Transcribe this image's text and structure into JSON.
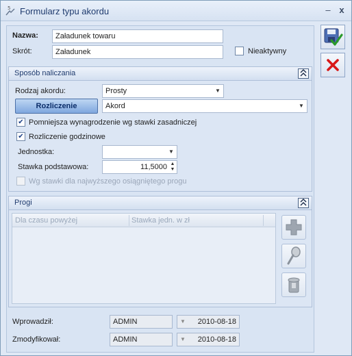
{
  "window": {
    "title": "Formularz typu akordu",
    "minimize_label": "–",
    "close_label": "x"
  },
  "header": {
    "name_label": "Nazwa:",
    "name_value": "Załadunek towaru",
    "short_label": "Skrót:",
    "short_value": "Załadunek",
    "inactive_label": "Nieaktywny",
    "inactive_checked": false
  },
  "calc_panel": {
    "title": "Sposób naliczania",
    "collapse_glyph": "⌃⌃",
    "type_label": "Rodzaj akordu:",
    "type_value": "Prosty",
    "settlement_button": "Rozliczenie",
    "settlement_value": "Akord",
    "reduce_label": "Pomniejsza wynagrodzenie wg stawki zasadniczej",
    "reduce_checked": true,
    "hourly_label": "Rozliczenie godzinowe",
    "hourly_checked": true,
    "unit_label": "Jednostka:",
    "unit_value": "",
    "base_rate_label": "Stawka podstawowa:",
    "base_rate_value": "11,5000",
    "highest_label": "Wg stawki dla najwyższego osiągniętego progu",
    "highest_checked": false
  },
  "thresholds_panel": {
    "title": "Progi",
    "collapse_glyph": "⌃⌃",
    "columns": [
      "Dla czasu powyżej",
      "Stawka jedn. w zł"
    ],
    "rows": [],
    "add_icon": "plus-icon",
    "edit_icon": "magnifier-icon",
    "delete_icon": "trash-icon"
  },
  "footer": {
    "entered_label": "Wprowadził:",
    "entered_user": "ADMIN",
    "entered_date": "2010-08-18",
    "modified_label": "Zmodyfikował:",
    "modified_user": "ADMIN",
    "modified_date": "2010-08-18"
  },
  "actions": {
    "save_icon": "save-icon",
    "cancel_icon": "cancel-icon"
  },
  "colors": {
    "save_check": "#2a9a2a",
    "cancel_x": "#d81818",
    "plus": "#9ea6b0"
  }
}
